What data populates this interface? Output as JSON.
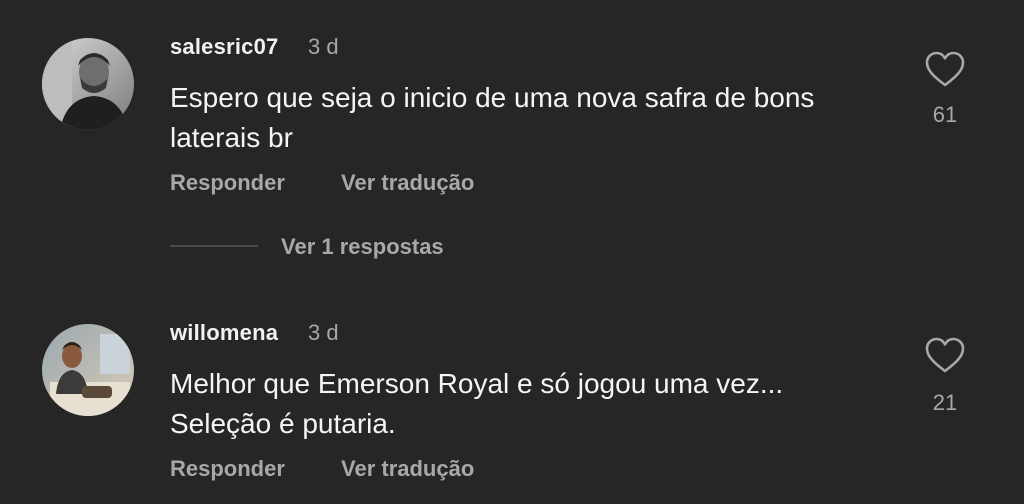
{
  "comments": [
    {
      "username": "salesric07",
      "time": "3 d",
      "text_lines": [
        "Espero que seja o inicio de uma nova safra de bons",
        "laterais br"
      ],
      "likes": "61",
      "reply_label": "Responder",
      "translate_label": "Ver tradução",
      "avatar_icon": "user-avatar-photo"
    },
    {
      "username": "willomena",
      "time": "3 d",
      "text_lines": [
        "Melhor que Emerson Royal e só jogou uma vez...",
        "Seleção é putaria."
      ],
      "likes": "21",
      "reply_label": "Responder",
      "translate_label": "Ver tradução",
      "avatar_icon": "user-avatar-photo"
    }
  ],
  "view_replies_label": "Ver 1 respostas",
  "colors": {
    "background": "#262626",
    "primary_text": "#f5f5f5",
    "secondary_text": "#a8a8a8"
  }
}
